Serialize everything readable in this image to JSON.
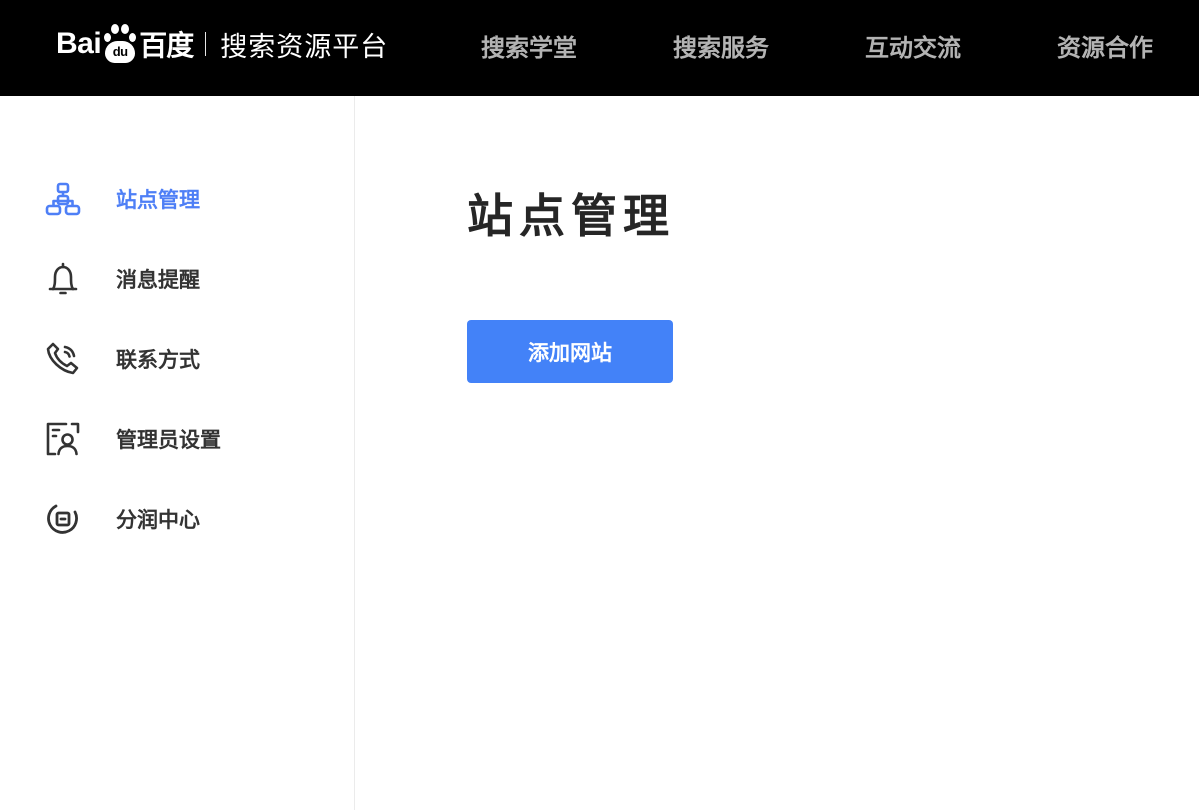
{
  "header": {
    "logo_latin": "Bai",
    "logo_paw_text": "du",
    "logo_chinese": "百度",
    "platform_name": "搜索资源平台",
    "nav": [
      {
        "label": "搜索学堂"
      },
      {
        "label": "搜索服务"
      },
      {
        "label": "互动交流"
      },
      {
        "label": "资源合作"
      }
    ]
  },
  "sidebar": {
    "items": [
      {
        "label": "站点管理",
        "icon": "site-structure-icon",
        "active": true
      },
      {
        "label": "消息提醒",
        "icon": "bell-icon",
        "active": false
      },
      {
        "label": "联系方式",
        "icon": "phone-icon",
        "active": false
      },
      {
        "label": "管理员设置",
        "icon": "admin-user-icon",
        "active": false
      },
      {
        "label": "分润中心",
        "icon": "revenue-share-icon",
        "active": false
      }
    ]
  },
  "main": {
    "title": "站点管理",
    "add_button_label": "添加网站"
  },
  "colors": {
    "accent": "#4382f8",
    "active_text": "#4e7ff6",
    "topbar_bg": "#000000",
    "nav_text": "#b3b3b3",
    "body_text": "#333333"
  }
}
